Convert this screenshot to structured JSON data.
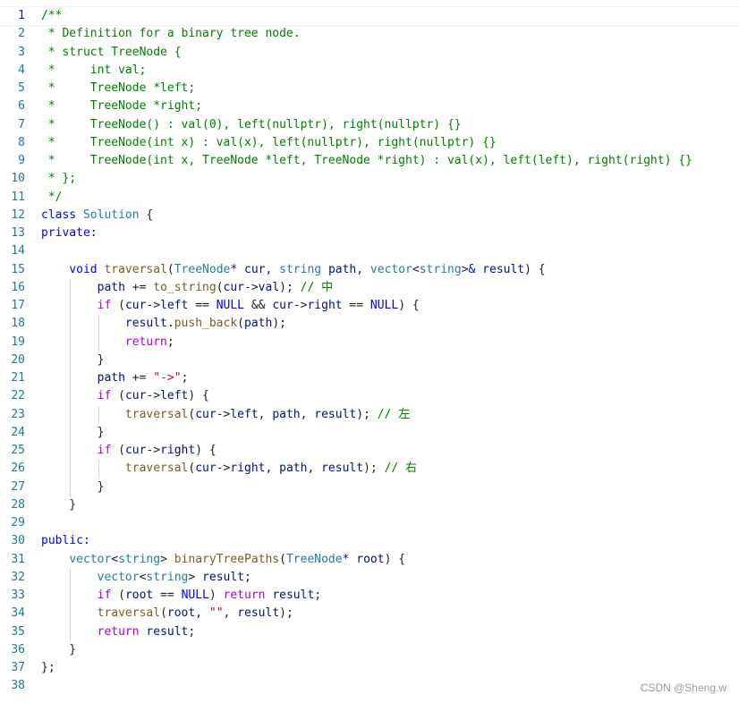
{
  "editor": {
    "lines": [
      {
        "n": "1",
        "tokens": [
          [
            "c",
            "/**"
          ]
        ]
      },
      {
        "n": "2",
        "tokens": [
          [
            "c",
            " * Definition for a binary tree node."
          ]
        ]
      },
      {
        "n": "3",
        "tokens": [
          [
            "c",
            " * struct TreeNode {"
          ]
        ]
      },
      {
        "n": "4",
        "tokens": [
          [
            "c",
            " *     int val;"
          ]
        ]
      },
      {
        "n": "5",
        "tokens": [
          [
            "c",
            " *     TreeNode *left;"
          ]
        ]
      },
      {
        "n": "6",
        "tokens": [
          [
            "c",
            " *     TreeNode *right;"
          ]
        ]
      },
      {
        "n": "7",
        "tokens": [
          [
            "c",
            " *     TreeNode() : val(0), left(nullptr), right(nullptr) {}"
          ]
        ]
      },
      {
        "n": "8",
        "tokens": [
          [
            "c",
            " *     TreeNode(int x) : val(x), left(nullptr), right(nullptr) {}"
          ]
        ]
      },
      {
        "n": "9",
        "tokens": [
          [
            "c",
            " *     TreeNode(int x, TreeNode *left, TreeNode *right) : val(x), left(left), right(right) {}"
          ]
        ]
      },
      {
        "n": "10",
        "tokens": [
          [
            "c",
            " * };"
          ]
        ]
      },
      {
        "n": "11",
        "tokens": [
          [
            "c",
            " */"
          ]
        ]
      },
      {
        "n": "12",
        "tokens": [
          [
            "k",
            "class "
          ],
          [
            "t",
            "Solution"
          ],
          [
            "p",
            " {"
          ]
        ]
      },
      {
        "n": "13",
        "tokens": [
          [
            "k",
            "private:"
          ]
        ]
      },
      {
        "n": "14",
        "tokens": []
      },
      {
        "n": "15",
        "tokens": [
          [
            "p",
            "    "
          ],
          [
            "k",
            "void "
          ],
          [
            "f",
            "traversal"
          ],
          [
            "p",
            "("
          ],
          [
            "t",
            "TreeNode"
          ],
          [
            "k",
            "* "
          ],
          [
            "v",
            "cur"
          ],
          [
            "p",
            ", "
          ],
          [
            "t",
            "string "
          ],
          [
            "v",
            "path"
          ],
          [
            "p",
            ", "
          ],
          [
            "t",
            "vector"
          ],
          [
            "p",
            "<"
          ],
          [
            "t",
            "string"
          ],
          [
            "p",
            ">"
          ],
          [
            "k",
            "& "
          ],
          [
            "v",
            "result"
          ],
          [
            "p",
            ") {"
          ]
        ]
      },
      {
        "n": "16",
        "tokens": [
          [
            "p",
            "        "
          ],
          [
            "v",
            "path"
          ],
          [
            "p",
            " += "
          ],
          [
            "f",
            "to_string"
          ],
          [
            "p",
            "("
          ],
          [
            "v",
            "cur"
          ],
          [
            "p",
            "->"
          ],
          [
            "v",
            "val"
          ],
          [
            "p",
            "); "
          ],
          [
            "c",
            "// 中"
          ]
        ]
      },
      {
        "n": "17",
        "tokens": [
          [
            "p",
            "        "
          ],
          [
            "ctl",
            "if"
          ],
          [
            "p",
            " ("
          ],
          [
            "v",
            "cur"
          ],
          [
            "p",
            "->"
          ],
          [
            "v",
            "left"
          ],
          [
            "p",
            " == "
          ],
          [
            "k",
            "NULL"
          ],
          [
            "p",
            " && "
          ],
          [
            "v",
            "cur"
          ],
          [
            "p",
            "->"
          ],
          [
            "v",
            "right"
          ],
          [
            "p",
            " == "
          ],
          [
            "k",
            "NULL"
          ],
          [
            "p",
            ") {"
          ]
        ]
      },
      {
        "n": "18",
        "tokens": [
          [
            "p",
            "            "
          ],
          [
            "v",
            "result"
          ],
          [
            "p",
            "."
          ],
          [
            "f",
            "push_back"
          ],
          [
            "p",
            "("
          ],
          [
            "v",
            "path"
          ],
          [
            "p",
            ");"
          ]
        ]
      },
      {
        "n": "19",
        "tokens": [
          [
            "p",
            "            "
          ],
          [
            "ctl",
            "return"
          ],
          [
            "p",
            ";"
          ]
        ]
      },
      {
        "n": "20",
        "tokens": [
          [
            "p",
            "        }"
          ]
        ]
      },
      {
        "n": "21",
        "tokens": [
          [
            "p",
            "        "
          ],
          [
            "v",
            "path"
          ],
          [
            "p",
            " += "
          ],
          [
            "s",
            "\"->\""
          ],
          [
            "p",
            ";"
          ]
        ]
      },
      {
        "n": "22",
        "tokens": [
          [
            "p",
            "        "
          ],
          [
            "ctl",
            "if"
          ],
          [
            "p",
            " ("
          ],
          [
            "v",
            "cur"
          ],
          [
            "p",
            "->"
          ],
          [
            "v",
            "left"
          ],
          [
            "p",
            ") {"
          ]
        ]
      },
      {
        "n": "23",
        "tokens": [
          [
            "p",
            "            "
          ],
          [
            "f",
            "traversal"
          ],
          [
            "p",
            "("
          ],
          [
            "v",
            "cur"
          ],
          [
            "p",
            "->"
          ],
          [
            "v",
            "left"
          ],
          [
            "p",
            ", "
          ],
          [
            "v",
            "path"
          ],
          [
            "p",
            ", "
          ],
          [
            "v",
            "result"
          ],
          [
            "p",
            "); "
          ],
          [
            "c",
            "// 左"
          ]
        ]
      },
      {
        "n": "24",
        "tokens": [
          [
            "p",
            "        }"
          ]
        ]
      },
      {
        "n": "25",
        "tokens": [
          [
            "p",
            "        "
          ],
          [
            "ctl",
            "if"
          ],
          [
            "p",
            " ("
          ],
          [
            "v",
            "cur"
          ],
          [
            "p",
            "->"
          ],
          [
            "v",
            "right"
          ],
          [
            "p",
            ") {"
          ]
        ]
      },
      {
        "n": "26",
        "tokens": [
          [
            "p",
            "            "
          ],
          [
            "f",
            "traversal"
          ],
          [
            "p",
            "("
          ],
          [
            "v",
            "cur"
          ],
          [
            "p",
            "->"
          ],
          [
            "v",
            "right"
          ],
          [
            "p",
            ", "
          ],
          [
            "v",
            "path"
          ],
          [
            "p",
            ", "
          ],
          [
            "v",
            "result"
          ],
          [
            "p",
            "); "
          ],
          [
            "c",
            "// 右"
          ]
        ]
      },
      {
        "n": "27",
        "tokens": [
          [
            "p",
            "        }"
          ]
        ]
      },
      {
        "n": "28",
        "tokens": [
          [
            "p",
            "    }"
          ]
        ]
      },
      {
        "n": "29",
        "tokens": []
      },
      {
        "n": "30",
        "tokens": [
          [
            "k",
            "public:"
          ]
        ]
      },
      {
        "n": "31",
        "tokens": [
          [
            "p",
            "    "
          ],
          [
            "t",
            "vector"
          ],
          [
            "p",
            "<"
          ],
          [
            "t",
            "string"
          ],
          [
            "p",
            "> "
          ],
          [
            "f",
            "binaryTreePaths"
          ],
          [
            "p",
            "("
          ],
          [
            "t",
            "TreeNode"
          ],
          [
            "k",
            "* "
          ],
          [
            "v",
            "root"
          ],
          [
            "p",
            ") {"
          ]
        ]
      },
      {
        "n": "32",
        "tokens": [
          [
            "p",
            "        "
          ],
          [
            "t",
            "vector"
          ],
          [
            "p",
            "<"
          ],
          [
            "t",
            "string"
          ],
          [
            "p",
            "> "
          ],
          [
            "v",
            "result"
          ],
          [
            "p",
            ";"
          ]
        ]
      },
      {
        "n": "33",
        "tokens": [
          [
            "p",
            "        "
          ],
          [
            "ctl",
            "if"
          ],
          [
            "p",
            " ("
          ],
          [
            "v",
            "root"
          ],
          [
            "p",
            " == "
          ],
          [
            "k",
            "NULL"
          ],
          [
            "p",
            ") "
          ],
          [
            "ctl",
            "return"
          ],
          [
            "p",
            " "
          ],
          [
            "v",
            "result"
          ],
          [
            "p",
            ";"
          ]
        ]
      },
      {
        "n": "34",
        "tokens": [
          [
            "p",
            "        "
          ],
          [
            "f",
            "traversal"
          ],
          [
            "p",
            "("
          ],
          [
            "v",
            "root"
          ],
          [
            "p",
            ", "
          ],
          [
            "s",
            "\"\""
          ],
          [
            "p",
            ", "
          ],
          [
            "v",
            "result"
          ],
          [
            "p",
            ");"
          ]
        ]
      },
      {
        "n": "35",
        "tokens": [
          [
            "p",
            "        "
          ],
          [
            "ctl",
            "return"
          ],
          [
            "p",
            " "
          ],
          [
            "v",
            "result"
          ],
          [
            "p",
            ";"
          ]
        ]
      },
      {
        "n": "36",
        "tokens": [
          [
            "p",
            "    }"
          ]
        ]
      },
      {
        "n": "37",
        "tokens": [
          [
            "p",
            "};"
          ]
        ]
      },
      {
        "n": "38",
        "tokens": []
      }
    ],
    "active_line": "1"
  },
  "watermark": "CSDN @Sheng.w",
  "colors": {
    "comment": "#008000",
    "keyword": "#0000ff",
    "control": "#af00db",
    "type": "#267f99",
    "function": "#795e26",
    "variable": "#001080",
    "string": "#a31515",
    "line_number": "#237893"
  }
}
